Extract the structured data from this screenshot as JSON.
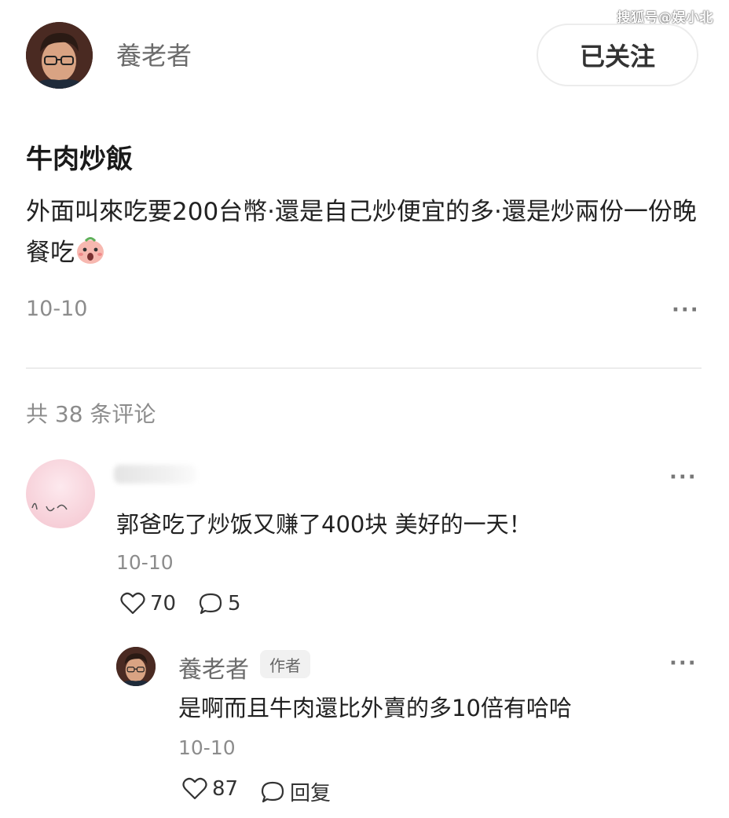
{
  "watermark": "搜狐号@娱小北",
  "post": {
    "author_name": "養老者",
    "follow_label": "已关注",
    "title": "牛肉炒飯",
    "body": "外面叫來吃要200台幣·還是自己炒便宜的多·還是炒兩份一份晚餐吃",
    "emoji": "scared-face-emoji",
    "date": "10-10",
    "more": "···"
  },
  "comments_header": "共 38 条评论",
  "comment": {
    "text": "郭爸吃了炒饭又赚了400块 美好的一天！",
    "date": "10-10",
    "likes": "70",
    "replies": "5",
    "more": "···"
  },
  "reply": {
    "author_name": "養老者",
    "author_tag": "作者",
    "text": "是啊而且牛肉還比外賣的多10倍有哈哈",
    "date": "10-10",
    "likes": "87",
    "reply_label": "回复",
    "more": "···"
  },
  "icons": {
    "like": "heart-outline-icon",
    "comment": "speech-bubble-icon",
    "more": "ellipsis-icon"
  }
}
